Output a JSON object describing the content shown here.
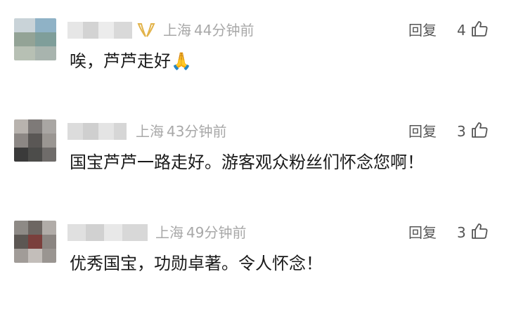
{
  "comments": [
    {
      "location": "上海",
      "time": "44分钟前",
      "reply_label": "回复",
      "likes": "4",
      "text": "唉，芦芦走好",
      "emoji": "🙏",
      "has_badge": true
    },
    {
      "location": "上海",
      "time": "43分钟前",
      "reply_label": "回复",
      "likes": "3",
      "text": "国宝芦芦一路走好。游客观众粉丝们怀念您啊！",
      "emoji": "",
      "has_badge": false
    },
    {
      "location": "上海",
      "time": "49分钟前",
      "reply_label": "回复",
      "likes": "3",
      "text": "优秀国宝，功勋卓著。令人怀念！",
      "emoji": "",
      "has_badge": false
    }
  ],
  "colors": {
    "meta_text": "#a8a8a8",
    "action_text": "#555555",
    "body_text": "#1a1a1a",
    "badge_gold": "#e2b34a"
  },
  "icons": [
    "thumbs-up-icon",
    "praying-hands-emoji",
    "gold-ribbon-badge-icon"
  ]
}
